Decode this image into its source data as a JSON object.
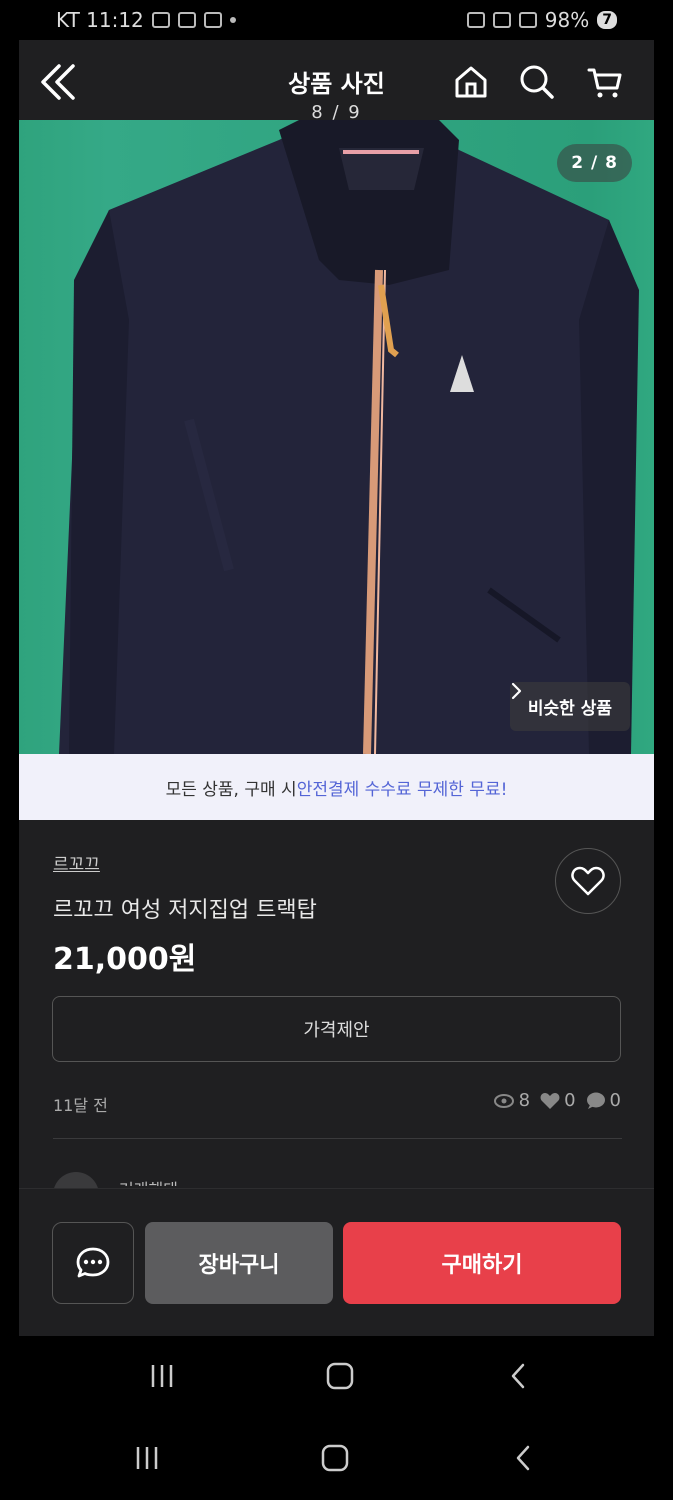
{
  "status_bar": {
    "carrier_time": "KT 11:12",
    "battery": "98%",
    "battery_badge": "7"
  },
  "header": {
    "title": "상품 사진",
    "photo_index": "8 / 9"
  },
  "photo": {
    "counter": "2 / 8",
    "similar_label": "비슷한 상품"
  },
  "promo": {
    "prefix": "모든 상품, 구매 시 ",
    "highlight": "안전결제 수수료 무제한 무료!"
  },
  "product": {
    "shop": "르꼬끄",
    "title": "르꼬끄 여성 저지집업 트랙탑",
    "price": "21,000원",
    "offer_label": "가격제안",
    "time_ago": "11달 전",
    "views": "8",
    "likes": "0",
    "chats": "0",
    "seller_peek": "거래해태"
  },
  "bottom_bar": {
    "cart_label": "장바구니",
    "buy_label": "구매하기"
  },
  "colors": {
    "buy_button": "#e8404a",
    "promo_highlight": "#5465d6",
    "background": "#1f1f21"
  }
}
